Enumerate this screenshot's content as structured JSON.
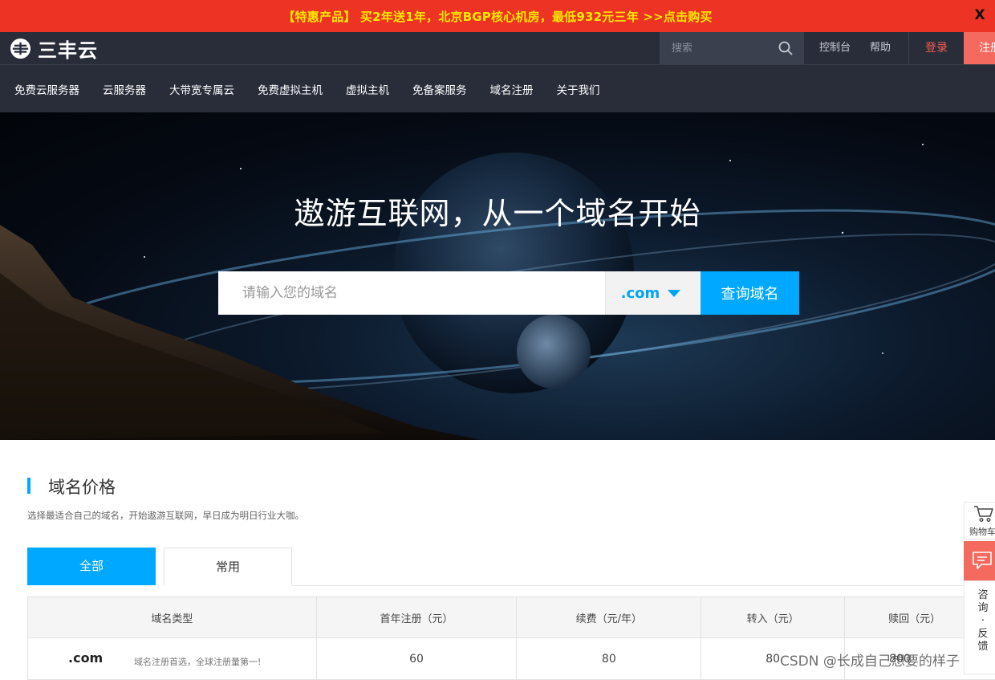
{
  "promo": {
    "text": "【特惠产品】 买2年送1年，北京BGP核心机房，最低932元三年 >>点击购买",
    "close_label": "X"
  },
  "header": {
    "logo_text": "三丰云",
    "search_placeholder": "搜索",
    "links": {
      "console": "控制台",
      "help": "帮助",
      "login": "登录",
      "register": "注册"
    }
  },
  "nav": {
    "items": [
      "免费云服务器",
      "云服务器",
      "大带宽专属云",
      "免费虚拟主机",
      "虚拟主机",
      "免备案服务",
      "域名注册",
      "关于我们"
    ]
  },
  "hero": {
    "title": "遨游互联网，从一个域名开始",
    "input_placeholder": "请输入您的域名",
    "tld_selected": ".com",
    "query_button": "查询域名"
  },
  "section": {
    "title": "域名价格",
    "subtitle": "选择最适合自己的域名，开始遨游互联网，早日成为明日行业大咖。",
    "tabs": [
      "全部",
      "常用"
    ]
  },
  "table": {
    "headers": [
      "域名类型",
      "首年注册（元）",
      "续费（元/年）",
      "转入（元）",
      "赎回（元）"
    ],
    "rows": [
      {
        "tld": ".com",
        "desc": "域名注册首选，全球注册量第一!",
        "first_year": "60",
        "renew": "80",
        "transfer": "80",
        "redeem": "800"
      }
    ]
  },
  "side": {
    "cart_label": "购物车",
    "consult_label": [
      "咨",
      "询",
      "·",
      "反",
      "馈"
    ]
  },
  "watermark": "CSDN @长成自己想要的样子",
  "colors": {
    "promo_bg": "#ec3324",
    "promo_text": "#ffe800",
    "header_bg": "#292d3a",
    "accent": "#00a8ff",
    "register_bg": "#f46a5f"
  }
}
